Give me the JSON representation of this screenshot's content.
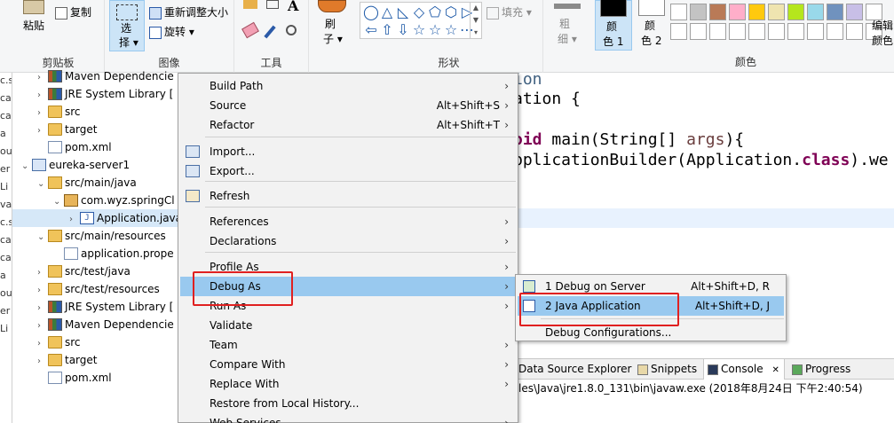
{
  "ribbon": {
    "clipboard": {
      "paste": "粘贴",
      "copy": "复制",
      "group_label": "剪贴板"
    },
    "image": {
      "select_line1": "选",
      "select_line2": "择",
      "resize": "重新调整大小",
      "rotate": "旋转",
      "group_label": "图像"
    },
    "tools": {
      "group_label": "工具",
      "text_tool": "A"
    },
    "brushes": {
      "line1": "刷",
      "line2": "子"
    },
    "shapes": {
      "fill": "填充",
      "group_label": "形状",
      "glyphs": [
        "◯",
        "△",
        "◺",
        "◇",
        "⬠",
        "⬡",
        "▷",
        "⇦",
        "⇧",
        "⇩",
        "☆",
        "☆",
        "☆",
        "⋯"
      ]
    },
    "size": {
      "line1": "粗",
      "line2": "细"
    },
    "color1": {
      "line1": "颜",
      "line2": "色 1"
    },
    "color2": {
      "line1": "颜",
      "line2": "色 2"
    },
    "colors": {
      "group_label": "颜色",
      "edit_line1": "编辑",
      "edit_line2": "颜色"
    },
    "palette_top": [
      "#ffffff",
      "#c3c3c3",
      "#b97a57",
      "#ffaec9",
      "#ffc90e",
      "#efe4b0",
      "#b5e61d",
      "#99d9ea",
      "#7092be",
      "#c8bfe7",
      "#ffffff"
    ],
    "palette_bottom": [
      "#ffffff",
      "#ffffff",
      "#ffffff",
      "#ffffff",
      "#ffffff",
      "#ffffff",
      "#ffffff",
      "#ffffff",
      "#ffffff",
      "#ffffff",
      "#ffffff"
    ]
  },
  "leftstrip": [
    "c.s",
    "ca",
    "ca",
    "a",
    "ou",
    "er",
    "Li",
    "va",
    "c.s",
    "ca",
    "ca",
    "a",
    "ou",
    "er",
    "Li"
  ],
  "explorer": {
    "rows": [
      {
        "label": "Maven Dependencie",
        "icon": "lib",
        "indent": 1,
        "chevron": "›"
      },
      {
        "label": "JRE System Library [",
        "icon": "lib",
        "indent": 1,
        "chevron": "›"
      },
      {
        "label": "src",
        "icon": "folder",
        "indent": 1,
        "chevron": "›"
      },
      {
        "label": "target",
        "icon": "folder",
        "indent": 1,
        "chevron": "›"
      },
      {
        "label": "pom.xml",
        "icon": "file",
        "indent": 1,
        "chevron": ""
      },
      {
        "label": "eureka-server1",
        "icon": "proj",
        "indent": 0,
        "chevron": "⌄"
      },
      {
        "label": "src/main/java",
        "icon": "pkgfolder",
        "indent": 1,
        "chevron": "⌄"
      },
      {
        "label": "com.wyz.springCl",
        "icon": "pkg",
        "indent": 2,
        "chevron": "⌄"
      },
      {
        "label": "Application.java",
        "icon": "java",
        "indent": 3,
        "chevron": "›"
      },
      {
        "label": "src/main/resources",
        "icon": "pkgfolder",
        "indent": 1,
        "chevron": "⌄"
      },
      {
        "label": "application.prope",
        "icon": "file",
        "indent": 2,
        "chevron": ""
      },
      {
        "label": "src/test/java",
        "icon": "pkgfolder",
        "indent": 1,
        "chevron": "›"
      },
      {
        "label": "src/test/resources",
        "icon": "pkgfolder",
        "indent": 1,
        "chevron": "›"
      },
      {
        "label": "JRE System Library [",
        "icon": "lib",
        "indent": 1,
        "chevron": "›"
      },
      {
        "label": "Maven Dependencie",
        "icon": "lib",
        "indent": 1,
        "chevron": "›"
      },
      {
        "label": "src",
        "icon": "folder",
        "indent": 1,
        "chevron": "›"
      },
      {
        "label": "target",
        "icon": "folder",
        "indent": 1,
        "chevron": "›"
      },
      {
        "label": "pom.xml",
        "icon": "file",
        "indent": 1,
        "chevron": ""
      }
    ]
  },
  "editor": {
    "line1": "ion",
    "line2": "ation {",
    "line3_kw": "oid",
    "line3_rest": " main(String[] ",
    "line3_param": "args",
    "line3_end": "){",
    "line4_a": "pplicationBuilder(Application.",
    "line4_kw": "class",
    "line4_b": ").we"
  },
  "context_menu": {
    "items": [
      {
        "label": "Build Path",
        "shortcut": "",
        "submenu": true
      },
      {
        "label": "Source",
        "shortcut": "Alt+Shift+S",
        "submenu": true
      },
      {
        "label": "Refactor",
        "shortcut": "Alt+Shift+T",
        "submenu": true
      },
      {
        "label": "Import...",
        "shortcut": "",
        "submenu": false
      },
      {
        "label": "Export...",
        "shortcut": "",
        "submenu": false
      },
      {
        "label": "Refresh",
        "shortcut": "",
        "submenu": false
      },
      {
        "label": "References",
        "shortcut": "",
        "submenu": true
      },
      {
        "label": "Declarations",
        "shortcut": "",
        "submenu": true
      },
      {
        "label": "Profile As",
        "shortcut": "",
        "submenu": true
      },
      {
        "label": "Debug As",
        "shortcut": "",
        "submenu": true
      },
      {
        "label": "Run As",
        "shortcut": "",
        "submenu": true
      },
      {
        "label": "Validate",
        "shortcut": "",
        "submenu": false
      },
      {
        "label": "Team",
        "shortcut": "",
        "submenu": true
      },
      {
        "label": "Compare With",
        "shortcut": "",
        "submenu": true
      },
      {
        "label": "Replace With",
        "shortcut": "",
        "submenu": true
      },
      {
        "label": "Restore from Local History...",
        "shortcut": "",
        "submenu": false
      },
      {
        "label": "Web Services",
        "shortcut": "",
        "submenu": true
      }
    ],
    "arrow": "›"
  },
  "debug_submenu": {
    "items": [
      {
        "label": "1 Debug on Server",
        "shortcut": "Alt+Shift+D, R"
      },
      {
        "label": "2 Java Application",
        "shortcut": "Alt+Shift+D, J"
      },
      {
        "label": "Debug Configurations...",
        "shortcut": ""
      }
    ]
  },
  "views": {
    "tabs": [
      "Data Source Explorer",
      "Snippets",
      "Console",
      "Progress"
    ],
    "console_close": "✕",
    "console_line": "les\\Java\\jre1.8.0_131\\bin\\javaw.exe (2018年8月24日 下午2:40:54)"
  }
}
